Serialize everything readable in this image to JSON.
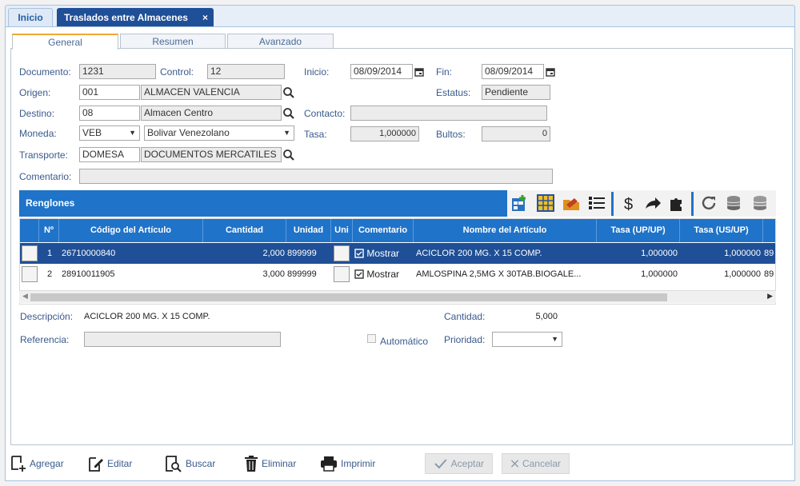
{
  "tabs": {
    "inicio": "Inicio",
    "active": "Traslados entre Almacenes",
    "close": "×"
  },
  "subtabs": [
    "General",
    "Resumen",
    "Avanzado"
  ],
  "form": {
    "documento_label": "Documento:",
    "documento": "1231",
    "control_label": "Control:",
    "control": "12",
    "inicio_label": "Inicio:",
    "inicio": "08/09/2014",
    "fin_label": "Fin:",
    "fin": "08/09/2014",
    "origen_label": "Origen:",
    "origen_code": "001",
    "origen_name": "ALMACEN VALENCIA",
    "estatus_label": "Estatus:",
    "estatus": "Pendiente",
    "destino_label": "Destino:",
    "destino_code": "08",
    "destino_name": "Almacen Centro",
    "contacto_label": "Contacto:",
    "contacto": "",
    "moneda_label": "Moneda:",
    "moneda_code": "VEB",
    "moneda_name": "Bolivar Venezolano",
    "tasa_label": "Tasa:",
    "tasa": "1,000000",
    "bultos_label": "Bultos:",
    "bultos": "0",
    "transporte_label": "Transporte:",
    "transporte_code": "DOMESA",
    "transporte_name": "DOCUMENTOS MERCATILES",
    "comentario_label": "Comentario:",
    "comentario": ""
  },
  "renglones": {
    "title": "Renglones",
    "headers": [
      "Nº",
      "Código del Artículo",
      "Cantidad",
      "Unidad",
      "Uni",
      "Comentario",
      "Nombre del Artículo",
      "Tasa (UP/UP)",
      "Tasa (US/UP)"
    ],
    "rows": [
      {
        "n": "1",
        "codigo": "26710000840",
        "cantidad": "2,000",
        "unidad": "899999",
        "comentario": "Mostrar",
        "nombre": "ACICLOR 200 MG. X 15 COMP.",
        "tasa_up": "1,000000",
        "tasa_us": "1,000000",
        "extra": "89"
      },
      {
        "n": "2",
        "codigo": "28910011905",
        "cantidad": "3,000",
        "unidad": "899999",
        "comentario": "Mostrar",
        "nombre": "AMLOSPINA 2,5MG X 30TAB.BIOGALE...",
        "tasa_up": "1,000000",
        "tasa_us": "1,000000",
        "extra": "89"
      }
    ]
  },
  "details": {
    "descripcion_label": "Descripción:",
    "descripcion": "ACICLOR 200 MG. X 15 COMP.",
    "cantidad_label": "Cantidad:",
    "cantidad": "5,000",
    "referencia_label": "Referencia:",
    "referencia": "",
    "automatico_label": "Automático",
    "prioridad_label": "Prioridad:",
    "prioridad": ""
  },
  "footer": {
    "agregar": "Agregar",
    "editar": "Editar",
    "buscar": "Buscar",
    "eliminar": "Eliminar",
    "imprimir": "Imprimir",
    "aceptar": "Aceptar",
    "cancelar": "Cancelar"
  },
  "colors": {
    "accent": "#1f73c9",
    "selected_row": "#1f4f96",
    "tab_highlight": "#f0a830"
  }
}
